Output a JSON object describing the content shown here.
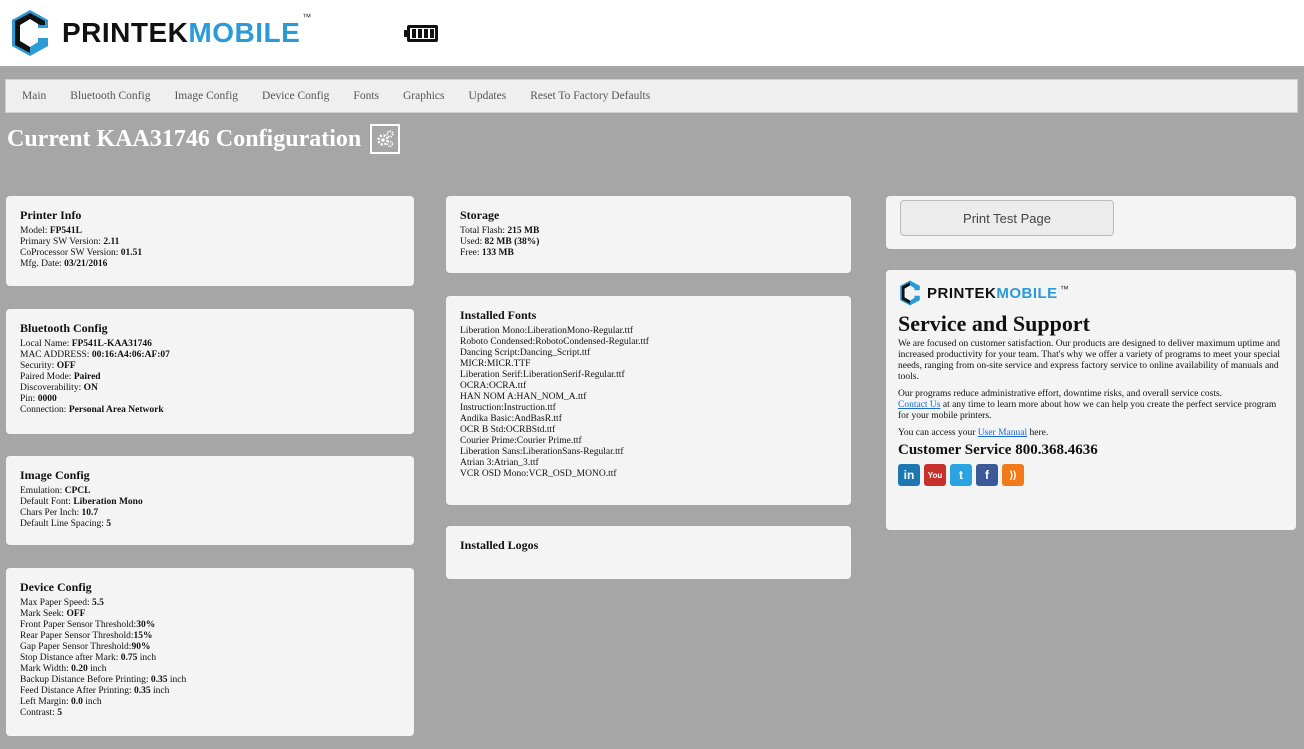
{
  "brand": {
    "name_a": "PRINTEK",
    "name_b": "MOBILE",
    "tm": "™"
  },
  "nav": [
    "Main",
    "Bluetooth Config",
    "Image Config",
    "Device Config",
    "Fonts",
    "Graphics",
    "Updates",
    "Reset To Factory Defaults"
  ],
  "page_title": "Current KAA31746 Configuration",
  "printer_info": {
    "title": "Printer Info",
    "rows": [
      {
        "label": "Model: ",
        "value": "FP541L"
      },
      {
        "label": "Primary SW Version: ",
        "value": "2.11"
      },
      {
        "label": "CoProcessor SW Version: ",
        "value": "01.51"
      },
      {
        "label": "Mfg. Date: ",
        "value": "03/21/2016"
      }
    ]
  },
  "bluetooth": {
    "title": "Bluetooth Config",
    "rows": [
      {
        "label": "Local Name: ",
        "value": "FP541L-KAA31746"
      },
      {
        "label": "MAC ADDRESS: ",
        "value": "00:16:A4:06:AF:07"
      },
      {
        "label": "Security: ",
        "value": "OFF"
      },
      {
        "label": "Paired Mode: ",
        "value": "Paired"
      },
      {
        "label": "Discoverability: ",
        "value": "ON"
      },
      {
        "label": "Pin: ",
        "value": "0000"
      },
      {
        "label": "Connection: ",
        "value": "Personal Area Network"
      }
    ]
  },
  "image_config": {
    "title": "Image Config",
    "rows": [
      {
        "label": "Emulation: ",
        "value": "CPCL"
      },
      {
        "label": "Default Font: ",
        "value": "Liberation Mono"
      },
      {
        "label": "Chars Per Inch: ",
        "value": "10.7"
      },
      {
        "label": "Default Line Spacing: ",
        "value": "5"
      }
    ]
  },
  "device_config": {
    "title": "Device Config",
    "rows": [
      {
        "label": "Max Paper Speed: ",
        "value": "5.5",
        "suffix": ""
      },
      {
        "label": "Mark Seek: ",
        "value": "OFF",
        "suffix": ""
      },
      {
        "label": "Front Paper Sensor Threshold:",
        "value": "30%",
        "suffix": ""
      },
      {
        "label": "Rear Paper Sensor Threshold:",
        "value": "15%",
        "suffix": ""
      },
      {
        "label": "Gap Paper Sensor Threshold:",
        "value": "90%",
        "suffix": ""
      },
      {
        "label": "Stop Distance after Mark: ",
        "value": "0.75",
        "suffix": " inch"
      },
      {
        "label": "Mark Width: ",
        "value": "0.20",
        "suffix": " inch"
      },
      {
        "label": "Backup Distance Before Printing: ",
        "value": "0.35",
        "suffix": " inch"
      },
      {
        "label": "Feed Distance After Printing: ",
        "value": "0.35",
        "suffix": " inch"
      },
      {
        "label": "Left Margin: ",
        "value": "0.0",
        "suffix": " inch"
      },
      {
        "label": "Contrast: ",
        "value": "5",
        "suffix": ""
      }
    ]
  },
  "storage": {
    "title": "Storage",
    "rows": [
      {
        "label": "Total Flash: ",
        "value": "215 MB"
      },
      {
        "label": "Used: ",
        "value": "82 MB (38%)"
      },
      {
        "label": "Free: ",
        "value": "133 MB"
      }
    ]
  },
  "fonts": {
    "title": "Installed Fonts",
    "items": [
      "Liberation Mono:LiberationMono-Regular.ttf",
      "Roboto Condensed:RobotoCondensed-Regular.ttf",
      "Dancing Script:Dancing_Script.ttf",
      "MICR:MICR.TTF",
      "Liberation Serif:LiberationSerif-Regular.ttf",
      "OCRA:OCRA.ttf",
      "HAN NOM A:HAN_NOM_A.ttf",
      "Instruction:Instruction.ttf",
      "Andika Basic:AndBasR.ttf",
      "OCR B Std:OCRBStd.ttf",
      "Courier Prime:Courier Prime.ttf",
      "Liberation Sans:LiberationSans-Regular.ttf",
      "Atrian 3:Atrian_3.ttf",
      "VCR OSD Mono:VCR_OSD_MONO.ttf"
    ]
  },
  "logos": {
    "title": "Installed Logos"
  },
  "print_test": "Print Test Page",
  "service": {
    "title": "Service and Support",
    "p1": "We are focused on customer satisfaction. Our products are designed to deliver maximum uptime and increased productivity for your team. That's why we offer a variety of programs to meet your special needs, ranging from on-site service and express factory service to online availability of manuals and tools.",
    "p2_pre": "Our programs reduce administrative effort, downtime risks, and overall service costs.",
    "contact_link": "Contact Us",
    "p2_post": " at any time to learn more about how we can help you create the perfect service program for your mobile printers.",
    "p3_pre": "You can access your ",
    "manual_link": "User Manual",
    "p3_post": " here.",
    "phone": "Customer Service 800.368.4636",
    "social": [
      {
        "name": "linkedin-icon",
        "glyph": "in",
        "color": "#1c77b3"
      },
      {
        "name": "youtube-icon",
        "glyph": "You",
        "color": "#c8302c"
      },
      {
        "name": "twitter-icon",
        "glyph": "t",
        "color": "#2aa3e0"
      },
      {
        "name": "facebook-icon",
        "glyph": "f",
        "color": "#3b5998"
      },
      {
        "name": "rss-icon",
        "glyph": "))",
        "color": "#f27a1a"
      }
    ]
  }
}
